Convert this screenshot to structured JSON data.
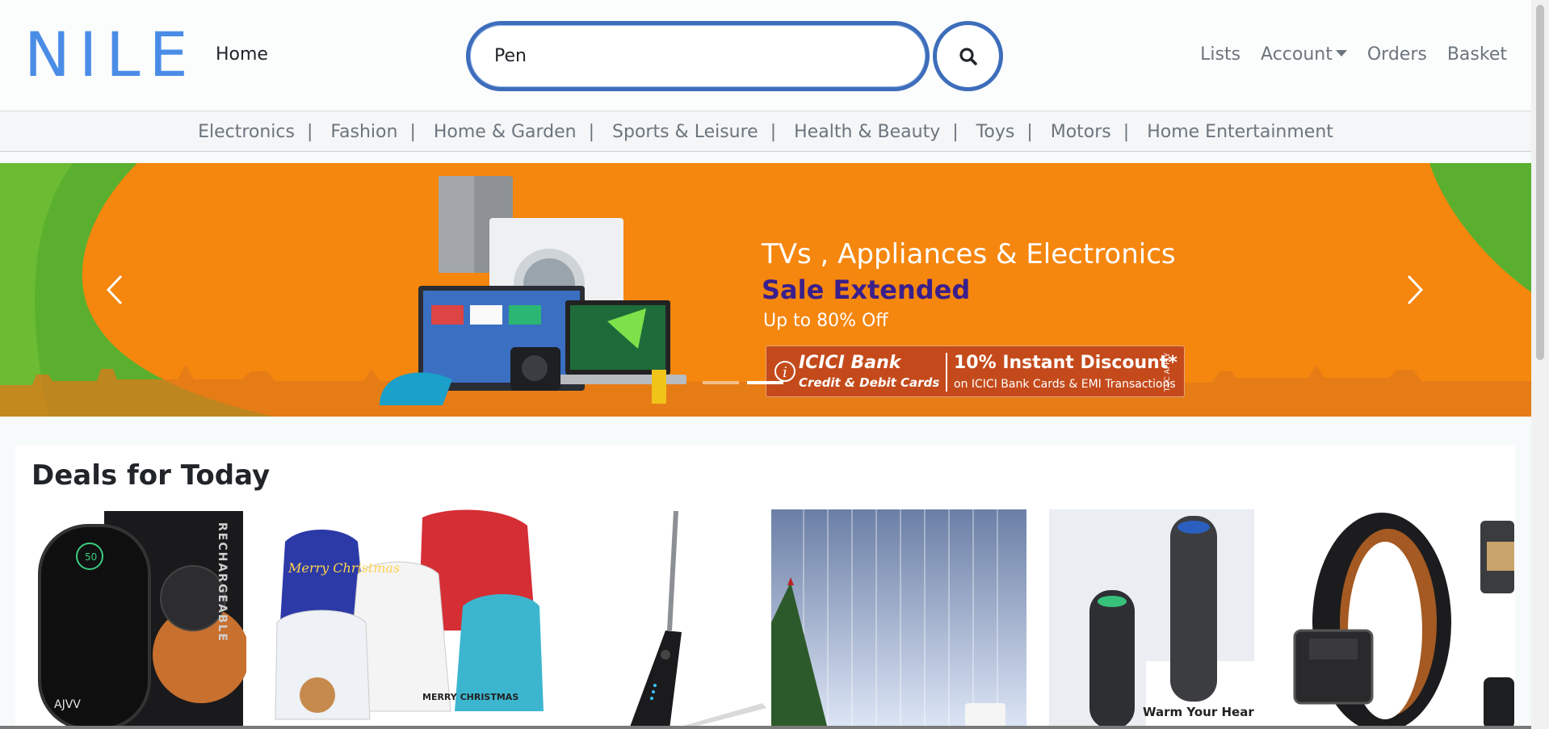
{
  "header": {
    "logo": "NILE",
    "home_label": "Home",
    "search": {
      "value": "Pen",
      "placeholder": ""
    },
    "nav": {
      "lists": "Lists",
      "account": "Account",
      "orders": "Orders",
      "basket": "Basket"
    }
  },
  "categories": [
    "Electronics",
    "Fashion",
    "Home & Garden",
    "Sports & Leisure",
    "Health & Beauty",
    "Toys",
    "Motors",
    "Home Entertainment"
  ],
  "banner": {
    "title": "TVs , Appliances & Electronics",
    "subtitle": "Sale Extended",
    "tagline": "Up to 80% Off",
    "offer": {
      "bank": "ICICI Bank",
      "cards": "Credit & Debit Cards",
      "discount": "10% Instant Discount*",
      "note": "on ICICI Bank Cards & EMI Transactions",
      "tc": "T&C APPLY"
    },
    "slides_count": 2,
    "active_slide": 1
  },
  "deals": {
    "title": "Deals for Today",
    "items": [
      {
        "name": "Rechargeable hand warmer",
        "box_text": "RECHARGEABLE",
        "brand": "AJVV",
        "display": "50"
      },
      {
        "name": "Christmas gift bags",
        "text1": "Merry Christmas",
        "text2": "MERRY CHRISTMAS"
      },
      {
        "name": "Electric candle lighter"
      },
      {
        "name": "Curtain fairy lights"
      },
      {
        "name": "Portable air purifier",
        "caption": "Warm Your Heart"
      },
      {
        "name": "Leather ratchet belt"
      },
      {
        "name": "Portable power station"
      }
    ]
  },
  "colors": {
    "brand": "#4a8de6",
    "search_border": "#3d6dbb",
    "banner_orange": "#f5860e",
    "banner_green": "#5ab02e",
    "sale_purple": "#3a1f8c"
  }
}
